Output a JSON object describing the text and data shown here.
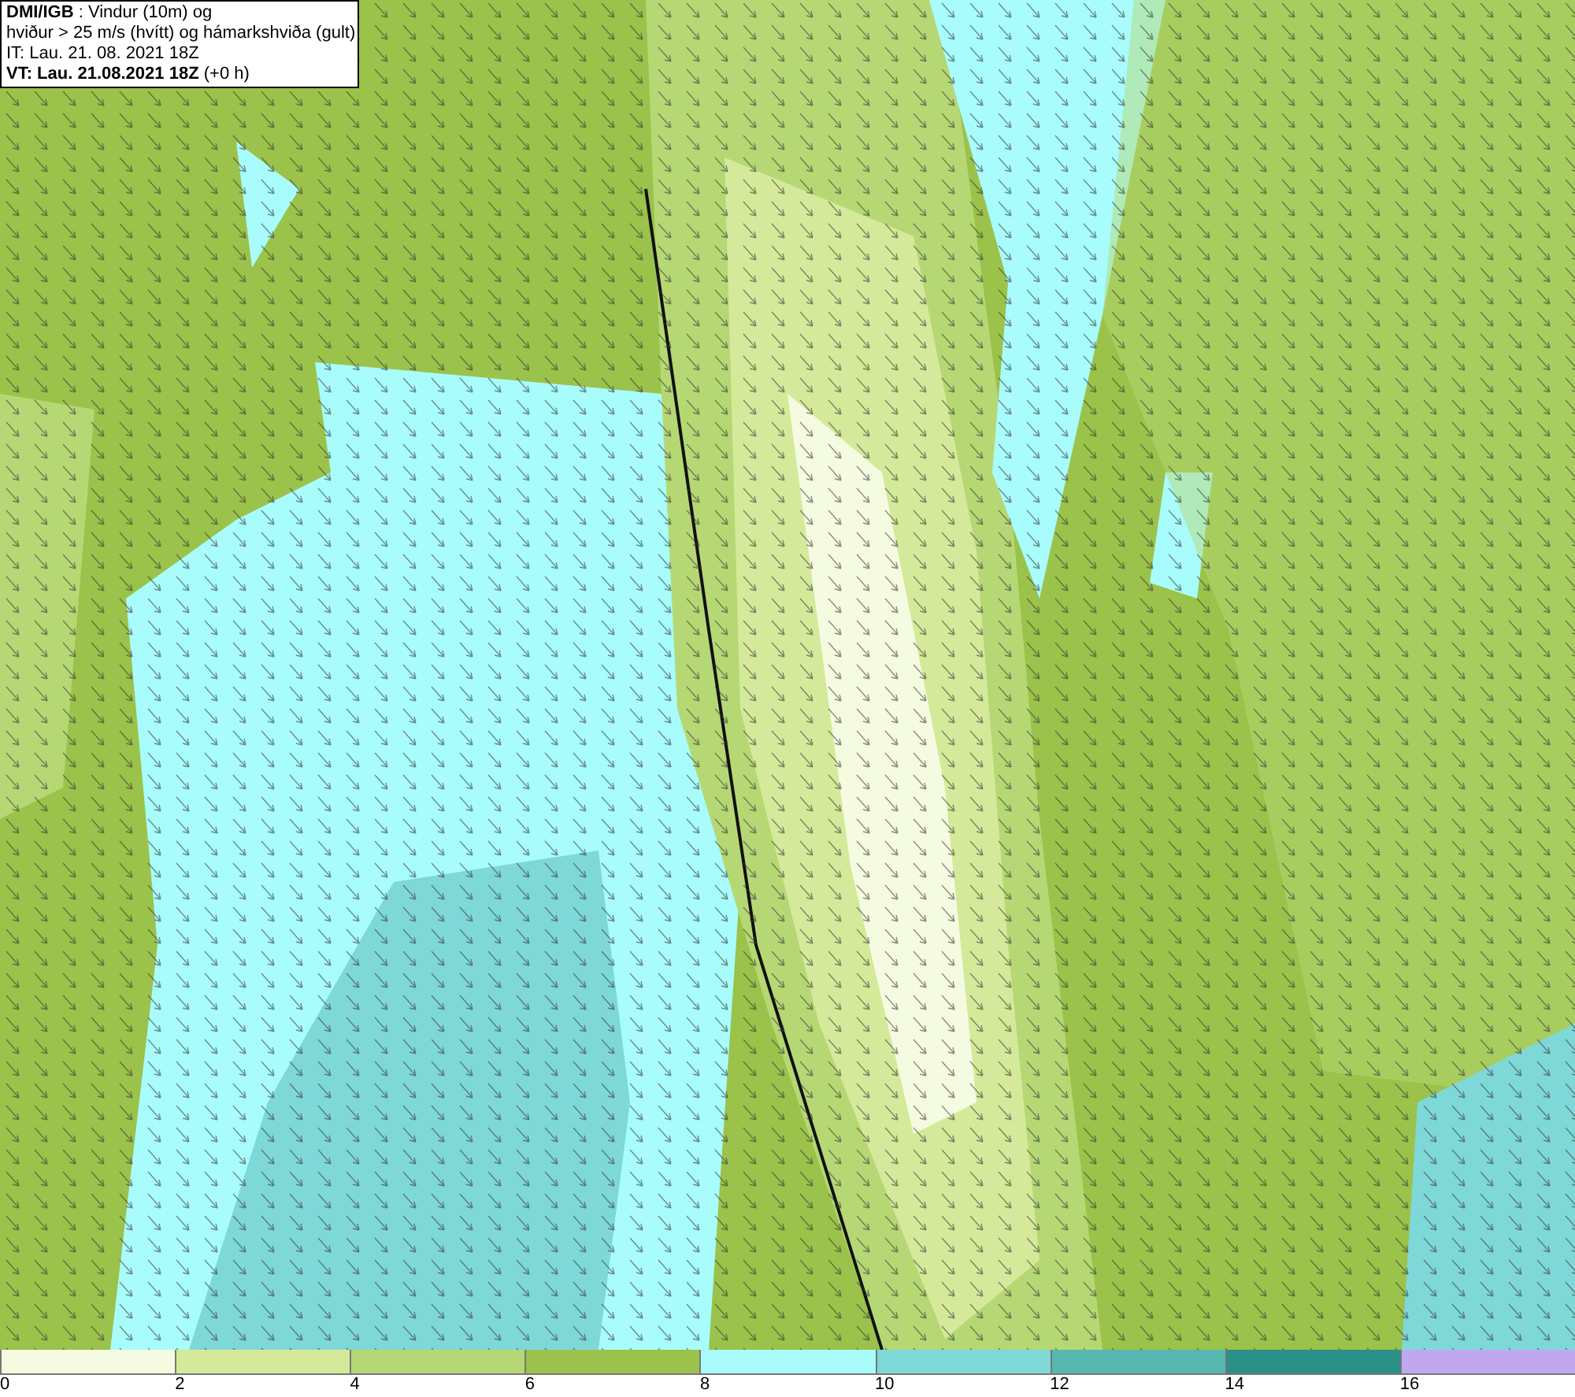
{
  "header": {
    "lines": [
      "**DMI/IGB** : Vindur (10m) og",
      "hviður > 25 m/s (hvítt) og hámarkshviða (gult)",
      "IT: Lau. 21. 08. 2021 18Z",
      "**VT: Lau. 21.08.2021 18Z** (+0 h)"
    ]
  },
  "legend": [
    {
      "color": "#f5fbe0",
      "label": "0"
    },
    {
      "color": "#d4ea9a",
      "label": "2"
    },
    {
      "color": "#b6d874",
      "label": "4"
    },
    {
      "color": "#9bc24a",
      "label": "6"
    },
    {
      "color": "#a8fcfc",
      "label": "8"
    },
    {
      "color": "#7fd8d8",
      "label": "10"
    },
    {
      "color": "#56b8b0",
      "label": "12"
    },
    {
      "color": "#2a9088",
      "label": "14"
    },
    {
      "color": "#c0a8f0",
      "label": "16"
    }
  ]
}
